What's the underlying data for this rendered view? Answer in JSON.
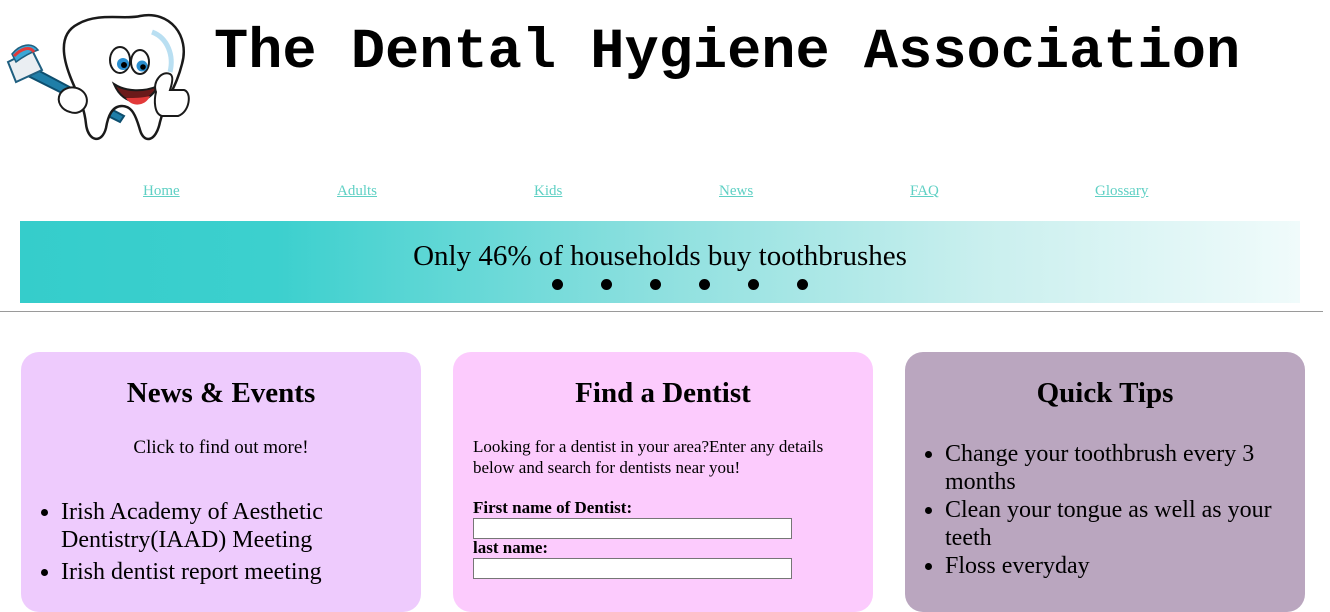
{
  "header": {
    "title": "The Dental Hygiene Association",
    "logo_icon": "cartoon-tooth-with-toothbrush-icon"
  },
  "nav": {
    "items": [
      {
        "label": "Home"
      },
      {
        "label": "Adults"
      },
      {
        "label": "Kids"
      },
      {
        "label": "News"
      },
      {
        "label": "FAQ"
      },
      {
        "label": "Glossary"
      }
    ]
  },
  "banner": {
    "text": "Only 46% of households buy toothbrushes",
    "slide_count": 6
  },
  "news": {
    "title": "News & Events",
    "subtitle": "Click to find out more!",
    "items": [
      "Irish Academy of Aesthetic Dentistry(IAAD) Meeting",
      "Irish dentist report meeting"
    ]
  },
  "find": {
    "title": "Find a Dentist",
    "intro": "Looking for a dentist in your area?Enter any details below and search for dentists near you!",
    "first_name_label": "First name of Dentist:",
    "first_name_value": "",
    "last_name_label": "last name:",
    "last_name_value": ""
  },
  "tips": {
    "title": "Quick Tips",
    "items": [
      "Change your toothbrush every 3 months",
      "Clean your tongue as well as your teeth",
      "Floss everyday"
    ]
  },
  "colors": {
    "link": "#5fd0c4",
    "banner_start": "#35cdcb",
    "news_card": "#eecbfd",
    "find_card": "#fccbfd",
    "tips_card": "#baa6bf"
  }
}
